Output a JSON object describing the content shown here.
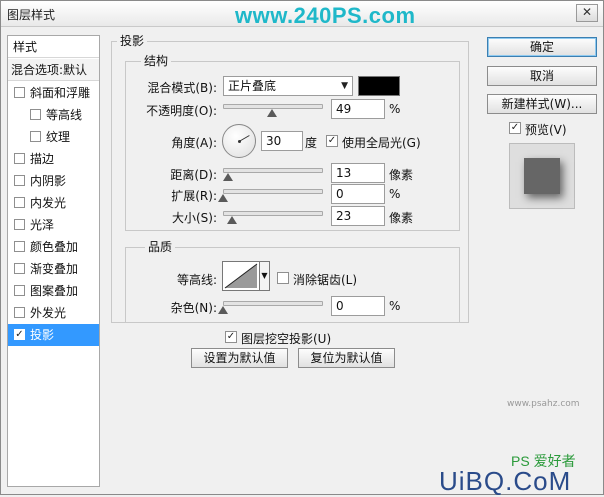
{
  "window": {
    "title": "图层样式",
    "watermark": "www.240PS.com",
    "close_glyph": "✕"
  },
  "style_list": {
    "heading": "样式",
    "blend_options": "混合选项:默认",
    "items": [
      {
        "label": "斜面和浮雕",
        "checked": false
      },
      {
        "label": "等高线",
        "checked": false
      },
      {
        "label": "纹理",
        "checked": false
      },
      {
        "label": "描边",
        "checked": false
      },
      {
        "label": "内阴影",
        "checked": false
      },
      {
        "label": "内发光",
        "checked": false
      },
      {
        "label": "光泽",
        "checked": false
      },
      {
        "label": "颜色叠加",
        "checked": false
      },
      {
        "label": "渐变叠加",
        "checked": false
      },
      {
        "label": "图案叠加",
        "checked": false
      },
      {
        "label": "外发光",
        "checked": false
      },
      {
        "label": "投影",
        "checked": true,
        "selected": true
      }
    ]
  },
  "drop_shadow": {
    "title": "投影",
    "structure": {
      "title": "结构",
      "blend_mode_label": "混合模式(B):",
      "blend_mode_value": "正片叠底",
      "shadow_color": "#000000",
      "opacity_label": "不透明度(O):",
      "opacity_value": "49",
      "opacity_unit": "%",
      "opacity_pct": 49,
      "angle_label": "角度(A):",
      "angle_value": "30",
      "angle_unit": "度",
      "global_light_label": "使用全局光(G)",
      "global_light_checked": true,
      "distance_label": "距离(D):",
      "distance_value": "13",
      "distance_unit": "像素",
      "distance_pct": 4.5,
      "spread_label": "扩展(R):",
      "spread_value": "0",
      "spread_unit": "%",
      "spread_pct": 0,
      "size_label": "大小(S):",
      "size_value": "23",
      "size_unit": "像素",
      "size_pct": 9
    },
    "quality": {
      "title": "品质",
      "contour_label": "等高线:",
      "antialias_label": "消除锯齿(L)",
      "antialias_checked": false,
      "noise_label": "杂色(N):",
      "noise_value": "0",
      "noise_unit": "%",
      "noise_pct": 0
    },
    "layer_knockout_label": "图层挖空投影(U)",
    "layer_knockout_checked": true,
    "make_default_label": "设置为默认值",
    "reset_default_label": "复位为默认值"
  },
  "buttons": {
    "ok": "确定",
    "cancel": "取消",
    "new_style": "新建样式(W)...",
    "preview_label": "预览(V)",
    "preview_checked": true
  },
  "watermarks": {
    "site_logo": "PS 爱好者",
    "site_url": "www.psahz.com",
    "uibq": "UiBQ.CoM"
  }
}
